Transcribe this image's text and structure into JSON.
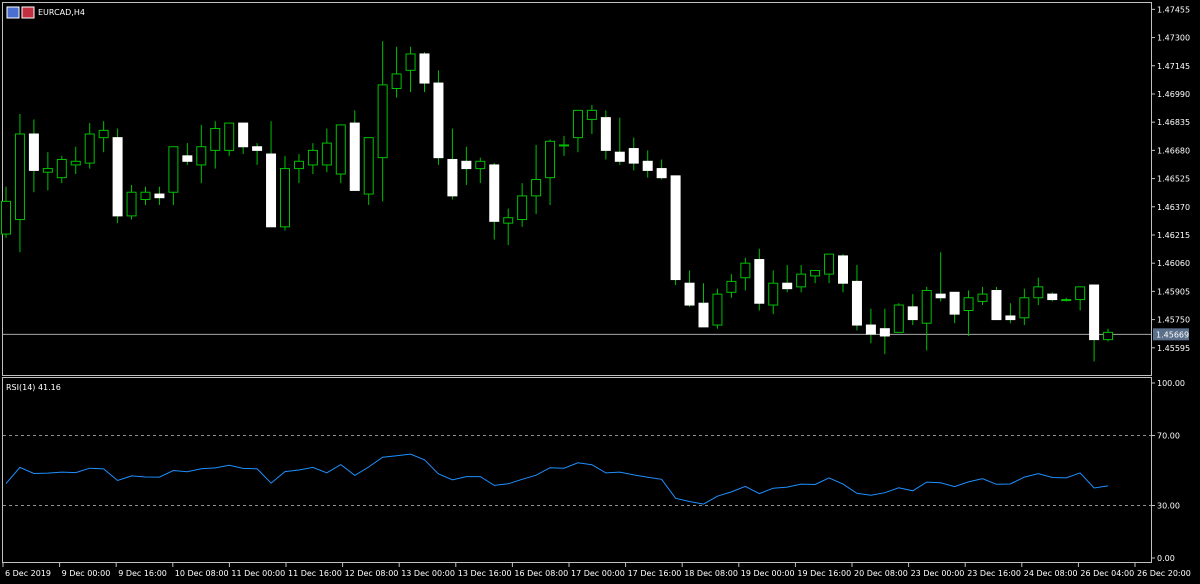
{
  "window": {
    "symbol_label": "EURCAD,H4",
    "indicator_label": "RSI(14) 41.16"
  },
  "colors": {
    "background": "#000000",
    "frame": "#c0c0c0",
    "bull_body": "#000000",
    "bull_outline": "#00c000",
    "bear_body": "#ffffff",
    "wick": "#00c000",
    "rsi_line": "#1e90ff",
    "level_line": "#c0c0c0",
    "bid_line": "#c0c0c0",
    "bid_label_bg": "#5a6f8a",
    "text": "#ffffff"
  },
  "chart_data": [
    {
      "type": "candlestick",
      "title": "EURCAD,H4",
      "ylim": [
        1.4544,
        1.4749
      ],
      "y_ticks": [
        "1.47455",
        "1.47300",
        "1.47145",
        "1.46990",
        "1.46835",
        "1.46680",
        "1.46525",
        "1.46370",
        "1.46215",
        "1.46060",
        "1.45905",
        "1.45750",
        "1.45595"
      ],
      "bid_price": "1.45669",
      "x_tick_labels": [
        "6 Dec 2019",
        "9 Dec 00:00",
        "9 Dec 16:00",
        "10 Dec 08:00",
        "11 Dec 00:00",
        "11 Dec 16:00",
        "12 Dec 08:00",
        "13 Dec 00:00",
        "13 Dec 16:00",
        "16 Dec 08:00",
        "17 Dec 00:00",
        "17 Dec 16:00",
        "18 Dec 08:00",
        "19 Dec 00:00",
        "19 Dec 16:00",
        "20 Dec 08:00",
        "23 Dec 00:00",
        "23 Dec 16:00",
        "24 Dec 08:00",
        "26 Dec 04:00",
        "26 Dec 20:00"
      ],
      "ohlc": [
        [
          1.4622,
          1.4648,
          1.462,
          1.464
        ],
        [
          1.463,
          1.4688,
          1.4612,
          1.4677
        ],
        [
          1.4677,
          1.4685,
          1.4645,
          1.4657
        ],
        [
          1.4656,
          1.4667,
          1.4646,
          1.4658
        ],
        [
          1.4653,
          1.4665,
          1.465,
          1.4663
        ],
        [
          1.466,
          1.467,
          1.4655,
          1.4662
        ],
        [
          1.4661,
          1.4683,
          1.4658,
          1.4677
        ],
        [
          1.4675,
          1.4684,
          1.4667,
          1.4679
        ],
        [
          1.4675,
          1.468,
          1.4628,
          1.4632
        ],
        [
          1.4632,
          1.4649,
          1.463,
          1.4645
        ],
        [
          1.4641,
          1.4648,
          1.4638,
          1.4645
        ],
        [
          1.4644,
          1.4648,
          1.4638,
          1.4642
        ],
        [
          1.4645,
          1.4666,
          1.4638,
          1.467
        ],
        [
          1.4665,
          1.4672,
          1.466,
          1.4662
        ],
        [
          1.466,
          1.4682,
          1.465,
          1.467
        ],
        [
          1.4668,
          1.4684,
          1.4658,
          1.468
        ],
        [
          1.4668,
          1.4682,
          1.4665,
          1.4683
        ],
        [
          1.4683,
          1.4675,
          1.4666,
          1.467
        ],
        [
          1.467,
          1.4672,
          1.466,
          1.4668
        ],
        [
          1.4666,
          1.4684,
          1.4627,
          1.4626
        ],
        [
          1.4626,
          1.4665,
          1.4624,
          1.4658
        ],
        [
          1.4658,
          1.4666,
          1.465,
          1.4662
        ],
        [
          1.466,
          1.4672,
          1.4655,
          1.4668
        ],
        [
          1.466,
          1.468,
          1.4656,
          1.4672
        ],
        [
          1.4655,
          1.4682,
          1.465,
          1.4682
        ],
        [
          1.4683,
          1.469,
          1.4648,
          1.4646
        ],
        [
          1.4644,
          1.4668,
          1.4638,
          1.4675
        ],
        [
          1.4664,
          1.4728,
          1.464,
          1.4704
        ],
        [
          1.4702,
          1.4725,
          1.4697,
          1.471
        ],
        [
          1.4712,
          1.4725,
          1.47,
          1.4721
        ],
        [
          1.4721,
          1.4722,
          1.47,
          1.4705
        ],
        [
          1.4705,
          1.4712,
          1.466,
          1.4664
        ],
        [
          1.4663,
          1.468,
          1.4641,
          1.4643
        ],
        [
          1.4662,
          1.467,
          1.4649,
          1.4658
        ],
        [
          1.4658,
          1.4664,
          1.465,
          1.4662
        ],
        [
          1.466,
          1.4661,
          1.4619,
          1.4629
        ],
        [
          1.4628,
          1.4636,
          1.4616,
          1.4631
        ],
        [
          1.463,
          1.465,
          1.4626,
          1.4643
        ],
        [
          1.4643,
          1.4671,
          1.4633,
          1.4652
        ],
        [
          1.4653,
          1.4674,
          1.4638,
          1.4673
        ],
        [
          1.4671,
          1.4676,
          1.4665,
          1.4671
        ],
        [
          1.4675,
          1.469,
          1.4667,
          1.469
        ],
        [
          1.4685,
          1.4693,
          1.4677,
          1.469
        ],
        [
          1.4686,
          1.469,
          1.4663,
          1.4668
        ],
        [
          1.4667,
          1.4686,
          1.466,
          1.4662
        ],
        [
          1.4669,
          1.4675,
          1.4657,
          1.4661
        ],
        [
          1.4662,
          1.4668,
          1.4653,
          1.4657
        ],
        [
          1.4658,
          1.4663,
          1.4652,
          1.4653
        ],
        [
          1.4654,
          1.4654,
          1.4594,
          1.4597
        ],
        [
          1.4595,
          1.4602,
          1.4582,
          1.4583
        ],
        [
          1.4584,
          1.4595,
          1.4571,
          1.4571
        ],
        [
          1.4572,
          1.4592,
          1.457,
          1.4589
        ],
        [
          1.459,
          1.46,
          1.4587,
          1.4596
        ],
        [
          1.4598,
          1.4609,
          1.4591,
          1.4606
        ],
        [
          1.4608,
          1.4614,
          1.458,
          1.4584
        ],
        [
          1.4583,
          1.4602,
          1.4578,
          1.4595
        ],
        [
          1.4595,
          1.4605,
          1.459,
          1.4592
        ],
        [
          1.4593,
          1.4605,
          1.459,
          1.46
        ],
        [
          1.4599,
          1.4601,
          1.4595,
          1.4602
        ],
        [
          1.46,
          1.4611,
          1.4595,
          1.4611
        ],
        [
          1.461,
          1.4611,
          1.459,
          1.4595
        ],
        [
          1.4596,
          1.4605,
          1.4569,
          1.4572
        ],
        [
          1.4572,
          1.4581,
          1.4562,
          1.4567
        ],
        [
          1.457,
          1.4581,
          1.4556,
          1.4566
        ],
        [
          1.4568,
          1.4584,
          1.457,
          1.4583
        ],
        [
          1.4582,
          1.4589,
          1.4572,
          1.4575
        ],
        [
          1.4573,
          1.4593,
          1.4558,
          1.4591
        ],
        [
          1.4589,
          1.4612,
          1.4585,
          1.4587
        ],
        [
          1.459,
          1.459,
          1.4573,
          1.4578
        ],
        [
          1.458,
          1.4591,
          1.4566,
          1.4587
        ],
        [
          1.4585,
          1.4593,
          1.4583,
          1.4589
        ],
        [
          1.4591,
          1.4593,
          1.4575,
          1.4575
        ],
        [
          1.4577,
          1.4584,
          1.4573,
          1.4575
        ],
        [
          1.4576,
          1.4592,
          1.4572,
          1.4587
        ],
        [
          1.4587,
          1.4598,
          1.4583,
          1.4593
        ],
        [
          1.4589,
          1.459,
          1.4585,
          1.4586
        ],
        [
          1.4586,
          1.4587,
          1.4585,
          1.4586
        ],
        [
          1.4586,
          1.4593,
          1.458,
          1.4593
        ],
        [
          1.4594,
          1.4594,
          1.4552,
          1.4564
        ],
        [
          1.4564,
          1.457,
          1.4563,
          1.4568
        ]
      ]
    },
    {
      "type": "line",
      "title": "RSI(14) 41.16",
      "ylim": [
        0,
        100
      ],
      "y_ticks": [
        "100.00",
        "70.00",
        "30.00",
        "0.00"
      ],
      "levels": [
        70,
        30
      ],
      "series": [
        {
          "name": "RSI(14)",
          "values": [
            42.5,
            51.8,
            48.3,
            48.5,
            49.1,
            48.8,
            51.3,
            50.9,
            44.3,
            46.9,
            46.3,
            46.2,
            50.0,
            49.3,
            51.0,
            51.5,
            53.0,
            51.2,
            51.0,
            42.8,
            49.4,
            50.3,
            51.8,
            48.7,
            53.4,
            47.2,
            52.0,
            57.6,
            58.4,
            59.4,
            56.1,
            48.1,
            44.7,
            46.5,
            46.5,
            41.5,
            42.4,
            45.0,
            47.3,
            51.6,
            51.3,
            54.4,
            53.3,
            48.6,
            49.1,
            47.5,
            46.1,
            45.0,
            34.1,
            32.3,
            30.8,
            35.3,
            37.8,
            40.9,
            36.8,
            39.9,
            40.5,
            42.2,
            42.0,
            45.8,
            42.2,
            37.0,
            35.9,
            37.3,
            40.1,
            38.4,
            43.4,
            43.0,
            40.8,
            43.5,
            45.3,
            42.1,
            42.3,
            46.2,
            48.2,
            46.0,
            45.8,
            48.6,
            40.0,
            41.2
          ]
        }
      ]
    }
  ]
}
